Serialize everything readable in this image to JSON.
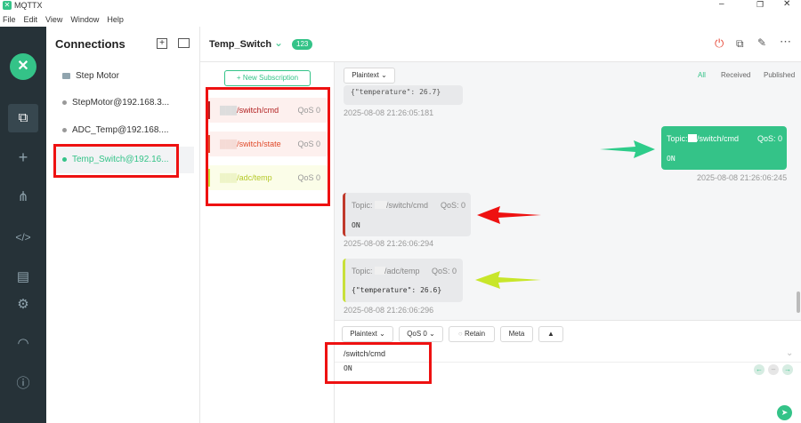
{
  "app": {
    "title": "MQTTX"
  },
  "menu": [
    "File",
    "Edit",
    "View",
    "Window",
    "Help"
  ],
  "connections": {
    "heading": "Connections",
    "items": [
      {
        "label": "Step Motor",
        "type": "folder"
      },
      {
        "label": "StepMotor@192.168.3...",
        "type": "conn"
      },
      {
        "label": "ADC_Temp@192.168....",
        "type": "conn"
      },
      {
        "label": "Temp_Switch@192.16...",
        "type": "conn",
        "active": true
      }
    ]
  },
  "header": {
    "title": "Temp_Switch",
    "count": "123"
  },
  "subscriptions": {
    "new_label": "New Subscription",
    "items": [
      {
        "topic": "/switch/cmd",
        "qos": "QoS 0",
        "color": "#b22222",
        "bg": "#fdf0ee"
      },
      {
        "topic": "/switch/state",
        "qos": "QoS 0",
        "color": "#e04b2b",
        "bg": "#fdf0ee"
      },
      {
        "topic": "/adc/temp",
        "qos": "QoS 0",
        "color": "#c8e03a",
        "bg": "#fbfde8"
      }
    ]
  },
  "toolbar": {
    "format": "Plaintext",
    "filters": [
      "All",
      "Received",
      "Published"
    ]
  },
  "messages": [
    {
      "payload": "{\"temperature\": 26.7}",
      "time": "2025-08-08 21:26:05:181"
    },
    {
      "topic_label": "Topic:",
      "topic": "/switch/cmd",
      "qos": "QoS: 0",
      "payload": "ON",
      "time": "2025-08-08 21:26:06:245",
      "direction": "out"
    },
    {
      "topic_label": "Topic:",
      "topic": "/switch/cmd",
      "qos": "QoS: 0",
      "payload": "ON",
      "time": "2025-08-08 21:26:06:294",
      "direction": "in"
    },
    {
      "topic_label": "Topic:",
      "topic": "/adc/temp",
      "qos": "QoS: 0",
      "payload": "{\"temperature\": 26.6}",
      "time": "2025-08-08 21:26:06:296",
      "direction": "in"
    }
  ],
  "composer": {
    "format": "Plaintext",
    "qos": "QoS 0",
    "retain": "Retain",
    "meta": "Meta",
    "topic": "/switch/cmd",
    "payload": "ON"
  },
  "colors": {
    "accent": "#34c388",
    "rail": "#263238",
    "annotation": "#e11111"
  }
}
